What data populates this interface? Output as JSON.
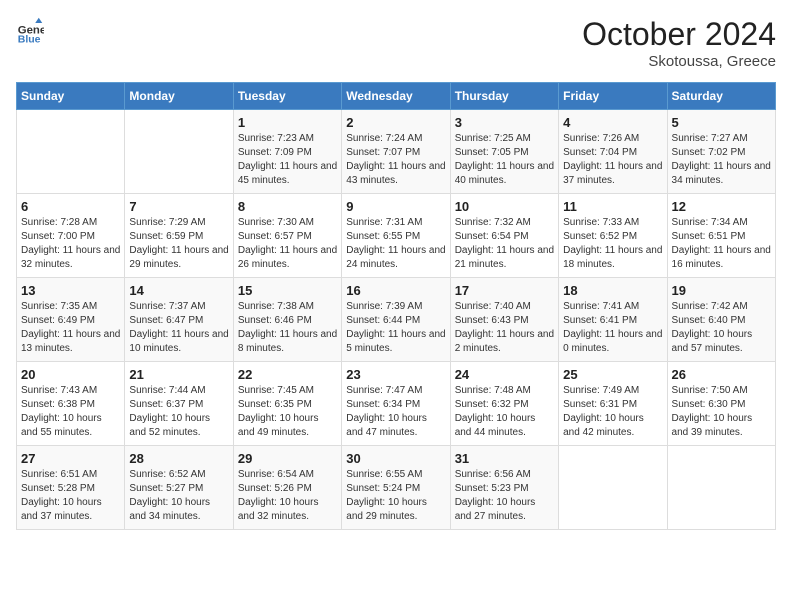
{
  "header": {
    "logo_line1": "General",
    "logo_line2": "Blue",
    "month": "October 2024",
    "location": "Skotoussa, Greece"
  },
  "weekdays": [
    "Sunday",
    "Monday",
    "Tuesday",
    "Wednesday",
    "Thursday",
    "Friday",
    "Saturday"
  ],
  "weeks": [
    [
      {
        "day": "",
        "info": ""
      },
      {
        "day": "",
        "info": ""
      },
      {
        "day": "1",
        "info": "Sunrise: 7:23 AM\nSunset: 7:09 PM\nDaylight: 11 hours and 45 minutes."
      },
      {
        "day": "2",
        "info": "Sunrise: 7:24 AM\nSunset: 7:07 PM\nDaylight: 11 hours and 43 minutes."
      },
      {
        "day": "3",
        "info": "Sunrise: 7:25 AM\nSunset: 7:05 PM\nDaylight: 11 hours and 40 minutes."
      },
      {
        "day": "4",
        "info": "Sunrise: 7:26 AM\nSunset: 7:04 PM\nDaylight: 11 hours and 37 minutes."
      },
      {
        "day": "5",
        "info": "Sunrise: 7:27 AM\nSunset: 7:02 PM\nDaylight: 11 hours and 34 minutes."
      }
    ],
    [
      {
        "day": "6",
        "info": "Sunrise: 7:28 AM\nSunset: 7:00 PM\nDaylight: 11 hours and 32 minutes."
      },
      {
        "day": "7",
        "info": "Sunrise: 7:29 AM\nSunset: 6:59 PM\nDaylight: 11 hours and 29 minutes."
      },
      {
        "day": "8",
        "info": "Sunrise: 7:30 AM\nSunset: 6:57 PM\nDaylight: 11 hours and 26 minutes."
      },
      {
        "day": "9",
        "info": "Sunrise: 7:31 AM\nSunset: 6:55 PM\nDaylight: 11 hours and 24 minutes."
      },
      {
        "day": "10",
        "info": "Sunrise: 7:32 AM\nSunset: 6:54 PM\nDaylight: 11 hours and 21 minutes."
      },
      {
        "day": "11",
        "info": "Sunrise: 7:33 AM\nSunset: 6:52 PM\nDaylight: 11 hours and 18 minutes."
      },
      {
        "day": "12",
        "info": "Sunrise: 7:34 AM\nSunset: 6:51 PM\nDaylight: 11 hours and 16 minutes."
      }
    ],
    [
      {
        "day": "13",
        "info": "Sunrise: 7:35 AM\nSunset: 6:49 PM\nDaylight: 11 hours and 13 minutes."
      },
      {
        "day": "14",
        "info": "Sunrise: 7:37 AM\nSunset: 6:47 PM\nDaylight: 11 hours and 10 minutes."
      },
      {
        "day": "15",
        "info": "Sunrise: 7:38 AM\nSunset: 6:46 PM\nDaylight: 11 hours and 8 minutes."
      },
      {
        "day": "16",
        "info": "Sunrise: 7:39 AM\nSunset: 6:44 PM\nDaylight: 11 hours and 5 minutes."
      },
      {
        "day": "17",
        "info": "Sunrise: 7:40 AM\nSunset: 6:43 PM\nDaylight: 11 hours and 2 minutes."
      },
      {
        "day": "18",
        "info": "Sunrise: 7:41 AM\nSunset: 6:41 PM\nDaylight: 11 hours and 0 minutes."
      },
      {
        "day": "19",
        "info": "Sunrise: 7:42 AM\nSunset: 6:40 PM\nDaylight: 10 hours and 57 minutes."
      }
    ],
    [
      {
        "day": "20",
        "info": "Sunrise: 7:43 AM\nSunset: 6:38 PM\nDaylight: 10 hours and 55 minutes."
      },
      {
        "day": "21",
        "info": "Sunrise: 7:44 AM\nSunset: 6:37 PM\nDaylight: 10 hours and 52 minutes."
      },
      {
        "day": "22",
        "info": "Sunrise: 7:45 AM\nSunset: 6:35 PM\nDaylight: 10 hours and 49 minutes."
      },
      {
        "day": "23",
        "info": "Sunrise: 7:47 AM\nSunset: 6:34 PM\nDaylight: 10 hours and 47 minutes."
      },
      {
        "day": "24",
        "info": "Sunrise: 7:48 AM\nSunset: 6:32 PM\nDaylight: 10 hours and 44 minutes."
      },
      {
        "day": "25",
        "info": "Sunrise: 7:49 AM\nSunset: 6:31 PM\nDaylight: 10 hours and 42 minutes."
      },
      {
        "day": "26",
        "info": "Sunrise: 7:50 AM\nSunset: 6:30 PM\nDaylight: 10 hours and 39 minutes."
      }
    ],
    [
      {
        "day": "27",
        "info": "Sunrise: 6:51 AM\nSunset: 5:28 PM\nDaylight: 10 hours and 37 minutes."
      },
      {
        "day": "28",
        "info": "Sunrise: 6:52 AM\nSunset: 5:27 PM\nDaylight: 10 hours and 34 minutes."
      },
      {
        "day": "29",
        "info": "Sunrise: 6:54 AM\nSunset: 5:26 PM\nDaylight: 10 hours and 32 minutes."
      },
      {
        "day": "30",
        "info": "Sunrise: 6:55 AM\nSunset: 5:24 PM\nDaylight: 10 hours and 29 minutes."
      },
      {
        "day": "31",
        "info": "Sunrise: 6:56 AM\nSunset: 5:23 PM\nDaylight: 10 hours and 27 minutes."
      },
      {
        "day": "",
        "info": ""
      },
      {
        "day": "",
        "info": ""
      }
    ]
  ]
}
